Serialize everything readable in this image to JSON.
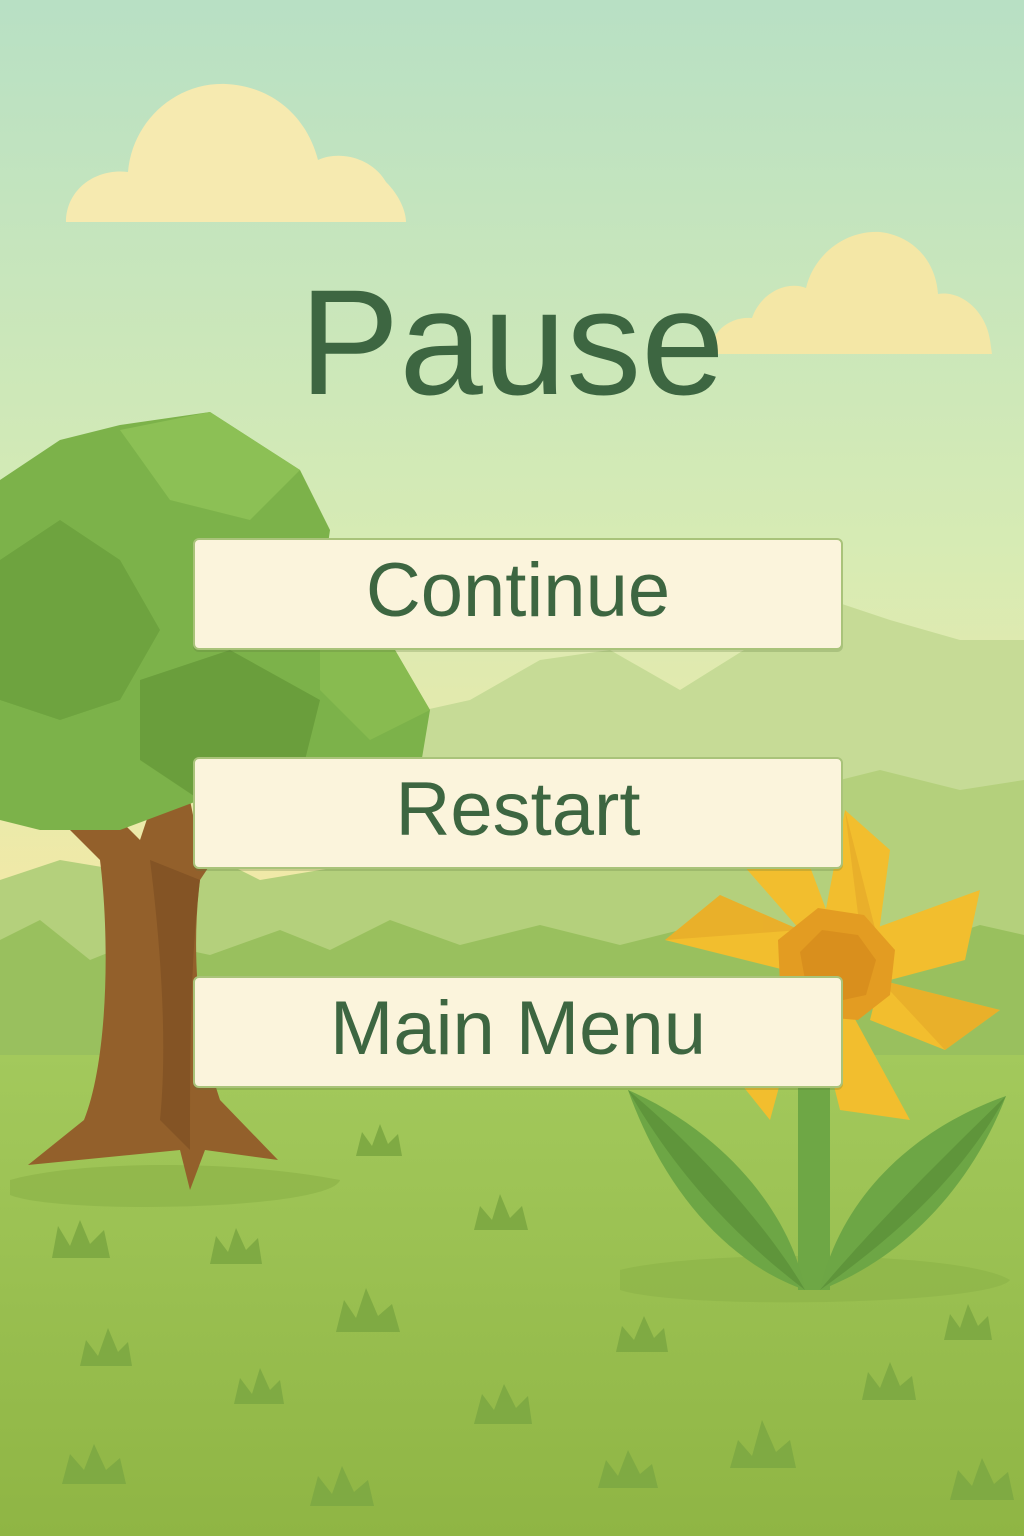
{
  "screen": {
    "title": "Pause"
  },
  "menu": {
    "continue_label": "Continue",
    "restart_label": "Restart",
    "main_menu_label": "Main Menu"
  },
  "colors": {
    "title_text": "#3d6641",
    "button_fill": "#fbf4dc",
    "button_border": "#a9c37a",
    "sky_top": "#b8e0c4",
    "sky_bottom": "#f3e9a6",
    "grass": "#9cc255",
    "flower_petal": "#f2be2e",
    "flower_center": "#e39c22",
    "tree_foliage": "#7cb24a",
    "tree_trunk": "#93602b"
  }
}
